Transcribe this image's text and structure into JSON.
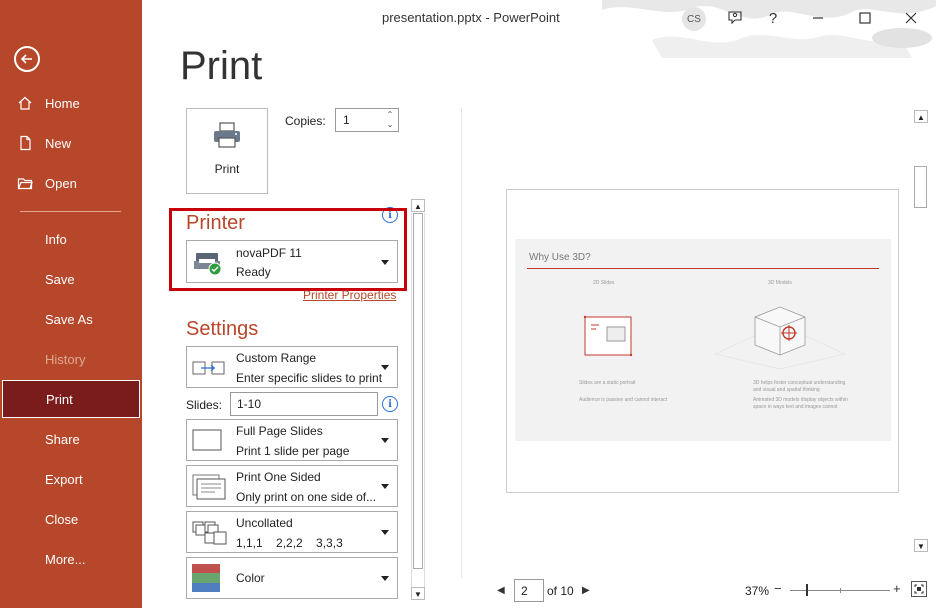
{
  "window": {
    "title": "presentation.pptx  -  PowerPoint",
    "user_initials": "CS",
    "help": "?"
  },
  "sidebar": {
    "items": [
      {
        "label": "Home",
        "icon": "home-icon"
      },
      {
        "label": "New",
        "icon": "new-file-icon"
      },
      {
        "label": "Open",
        "icon": "open-folder-icon"
      },
      {
        "label": "Info"
      },
      {
        "label": "Save"
      },
      {
        "label": "Save As"
      },
      {
        "label": "History",
        "disabled": true
      },
      {
        "label": "Print",
        "active": true
      },
      {
        "label": "Share"
      },
      {
        "label": "Export"
      },
      {
        "label": "Close"
      },
      {
        "label": "More..."
      }
    ]
  },
  "page_title": "Print",
  "print_button": {
    "label": "Print"
  },
  "copies": {
    "label": "Copies:",
    "value": "1"
  },
  "printer": {
    "heading": "Printer",
    "name": "novaPDF 11",
    "status": "Ready",
    "properties_link": "Printer Properties"
  },
  "settings": {
    "heading": "Settings",
    "range": {
      "title": "Custom Range",
      "subtitle": "Enter specific slides to print"
    },
    "slides_label": "Slides:",
    "slides_value": "1-10",
    "layout": {
      "title": "Full Page Slides",
      "subtitle": "Print 1 slide per page"
    },
    "sides": {
      "title": "Print One Sided",
      "subtitle": "Only print on one side of..."
    },
    "collation": {
      "title": "Uncollated",
      "subtitle": "1,1,1    2,2,2    3,3,3"
    },
    "color": {
      "title": "Color"
    }
  },
  "preview": {
    "slide_title": "Why Use 3D?",
    "col_left_title": "2D Slides",
    "col_right_title": "3D Models",
    "left_text_1": "Slides are a static portrait",
    "left_text_2": "Audience is passive and cannot interact",
    "right_text_1": "3D helps foster conceptual understanding and visual and spatial thinking",
    "right_text_2": "Animated 3D models display objects within space in ways text and images cannot"
  },
  "pager": {
    "current": "2",
    "of_label": "of 10"
  },
  "zoom": {
    "label": "37%"
  },
  "colors": {
    "accent": "#b7472a",
    "active_item": "#7b1c1c",
    "highlight": "#c8000a"
  }
}
